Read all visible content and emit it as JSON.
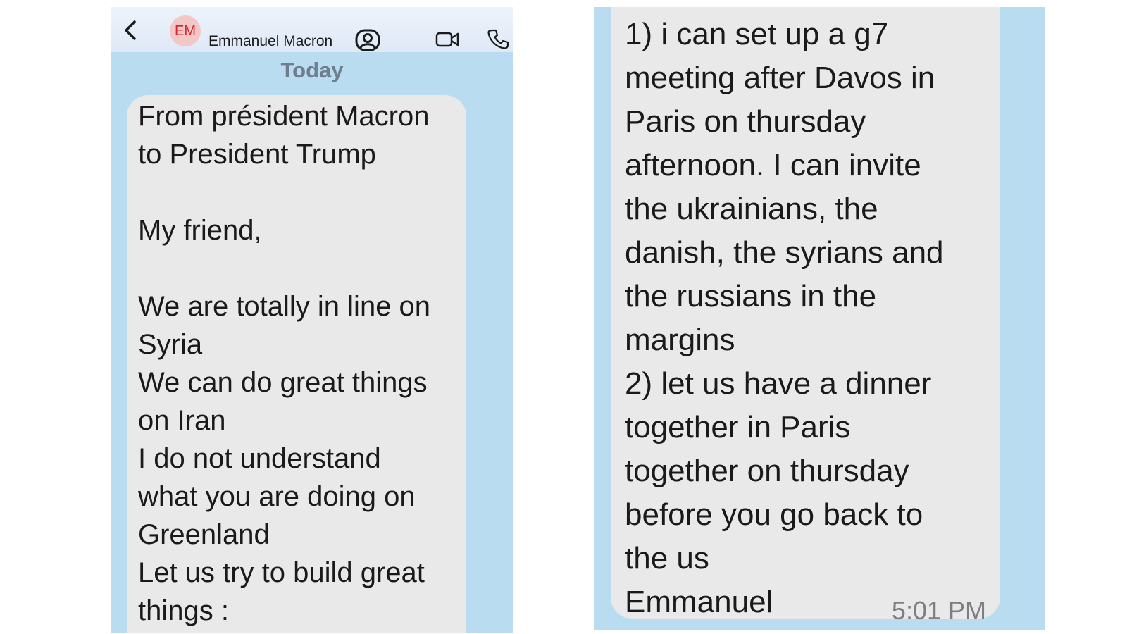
{
  "header": {
    "avatar_initials": "EM",
    "contact_name": "Emmanuel Macron",
    "icons": [
      "chevron-left-icon",
      "contact-card-icon",
      "video-icon",
      "phone-icon"
    ]
  },
  "conversation": {
    "day_label": "Today",
    "message_part_1": "From président Macron\nto President Trump\n\nMy friend,\n\nWe are totally in line on\nSyria\nWe can do great things\non Iran\nI do not understand\nwhat you are doing on\nGreenland\nLet us try to build great\nthings :",
    "message_part_2": "1) i can set up a g7\nmeeting after Davos in\nParis on thursday\nafternoon. I can invite\nthe ukrainians, the\ndanish, the syrians and\nthe russians in the\nmargins\n2) let us have a dinner\ntogether in Paris\ntogether on thursday\nbefore you go back to\nthe us\nEmmanuel",
    "timestamp": "5:01 PM"
  },
  "colors": {
    "background": "#b9dcf0",
    "bubble": "#e9e9ea",
    "header": "#e4edf8",
    "avatar_bg": "#f4c7c7",
    "avatar_text": "#d7262d",
    "day_label": "#6f7d8c"
  }
}
